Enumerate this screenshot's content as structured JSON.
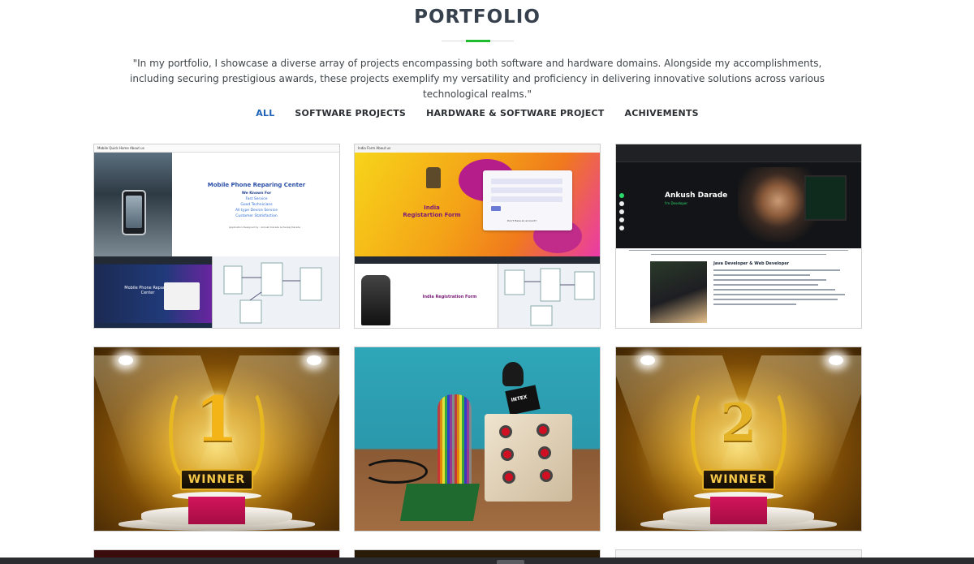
{
  "section": {
    "title": "PORTFOLIO",
    "intro": "\"In my portfolio, I showcase a diverse array of projects encompassing both software and hardware domains. Alongside my accomplishments, including securing prestigious awards, these projects exemplify my versatility and proficiency in delivering innovative solutions across various technological realms.\"",
    "accent_color": "#1fbb2f"
  },
  "filters": [
    {
      "label": "ALL",
      "active": true
    },
    {
      "label": "SOFTWARE PROJECTS",
      "active": false
    },
    {
      "label": "HARDWARE & SOFTWARE PROJECT",
      "active": false
    },
    {
      "label": "ACHIVEMENTS",
      "active": false
    }
  ],
  "active_filter_color": "#1f63b8",
  "cards": {
    "mobile": {
      "nav": "Mobile Quick   Home   About us",
      "title": "Mobile Phone Reparing Center",
      "lines": [
        "We Known For",
        "Fast Service",
        "Good Technicians",
        "All type Device Service",
        "Customer Statisfaction"
      ],
      "footer": "Application Designed by : Ankush Darade & Pankaj Darade",
      "bottom_title": "Mobile Phone Reparing Center"
    },
    "india": {
      "nav": "India   Form   About us",
      "heading_line1": "India",
      "heading_line2": "Registartion Form",
      "note": "Don't Have an account?",
      "bottom_title": "India Registration Form"
    },
    "ankush": {
      "name": "Ankush Darade",
      "role": "I'm Developer",
      "heading": "Java Developer & Web Developer"
    },
    "award1": {
      "number": "1",
      "label": "WINNER"
    },
    "hardware": {
      "label": "INTEX"
    },
    "award2": {
      "number": "2",
      "label": "WINNER"
    }
  }
}
